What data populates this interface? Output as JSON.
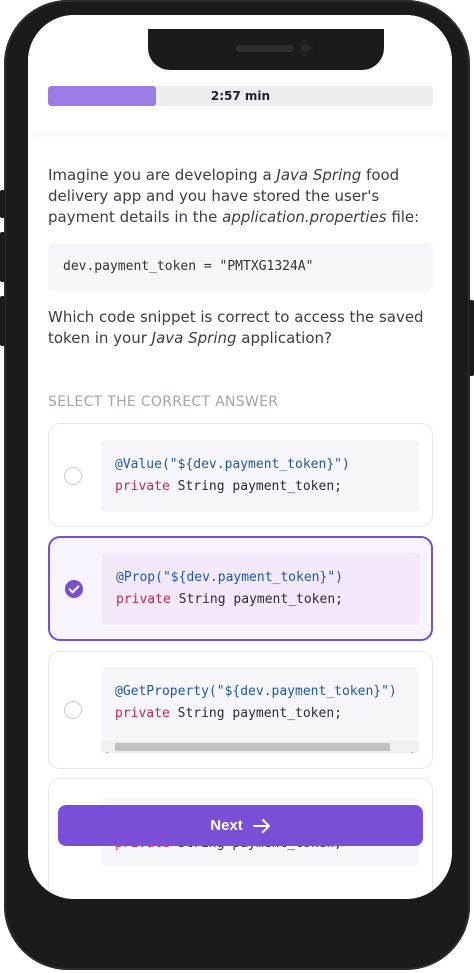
{
  "progress": {
    "time_left": "2:57 min",
    "fraction": 0.28
  },
  "question": {
    "part1_a": "Imagine you are developing a ",
    "part1_b": "Java Spring",
    "part1_c": " food delivery app and you have stored the user's payment details in the ",
    "part1_d": "application.properties",
    "part1_e": " file:",
    "code": "dev.payment_token = \"PMTXG1324A\"",
    "part2_a": "Which code snippet is correct to access the saved token in your ",
    "part2_b": "Java Spring",
    "part2_c": " application?"
  },
  "select_label": "SELECT THE CORRECT ANSWER",
  "options": [
    {
      "annotation": "@Value(\"${dev.payment_token}\")",
      "keyword": "private",
      "rest": " String payment_token;",
      "selected": false
    },
    {
      "annotation": "@Prop(\"${dev.payment_token}\")",
      "keyword": "private",
      "rest": " String payment_token;",
      "selected": true
    },
    {
      "annotation": "@GetProperty(\"${dev.payment_token}\")",
      "keyword": "private",
      "rest": " String payment_token;",
      "selected": false
    },
    {
      "annotation": "",
      "keyword": "private",
      "rest": " String payment_token;",
      "selected": false
    }
  ],
  "next_button": {
    "label": "Next"
  },
  "colors": {
    "accent": "#7a4fd8",
    "progress": "#9b7be6"
  }
}
